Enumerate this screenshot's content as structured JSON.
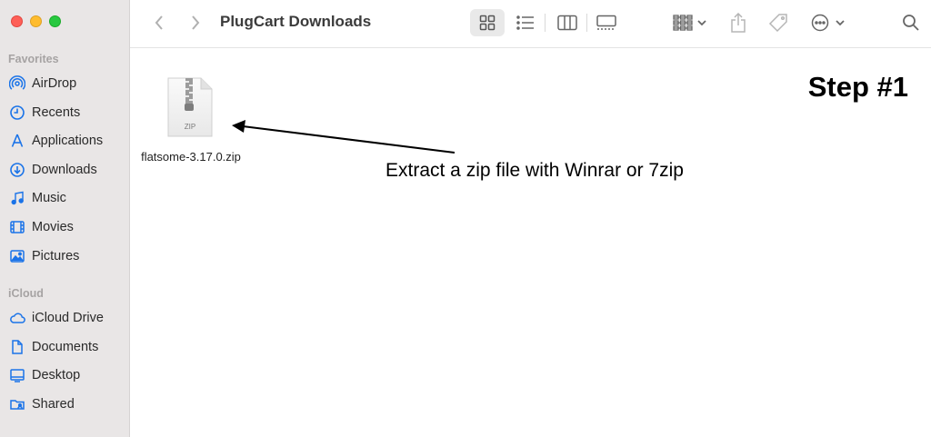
{
  "window": {
    "title": "PlugCart Downloads"
  },
  "sidebar": {
    "favorites_header": "Favorites",
    "favorites": [
      {
        "label": "AirDrop",
        "icon": "airdrop-icon"
      },
      {
        "label": "Recents",
        "icon": "clock-icon"
      },
      {
        "label": "Applications",
        "icon": "applications-icon"
      },
      {
        "label": "Downloads",
        "icon": "download-icon"
      },
      {
        "label": "Music",
        "icon": "music-note-icon"
      },
      {
        "label": "Movies",
        "icon": "film-icon"
      },
      {
        "label": "Pictures",
        "icon": "photo-icon"
      }
    ],
    "icloud_header": "iCloud",
    "icloud": [
      {
        "label": "iCloud Drive",
        "icon": "cloud-icon"
      },
      {
        "label": "Documents",
        "icon": "document-icon"
      },
      {
        "label": "Desktop",
        "icon": "desktop-icon"
      },
      {
        "label": "Shared",
        "icon": "shared-folder-icon"
      }
    ]
  },
  "toolbar": {
    "buttons": [
      "back-icon",
      "forward-icon",
      "grid-view-icon",
      "list-view-icon",
      "column-view-icon",
      "gallery-view-icon",
      "group-icon",
      "share-icon",
      "tag-icon",
      "more-icon",
      "search-icon"
    ],
    "selected_view": "grid-view-icon"
  },
  "files": [
    {
      "name": "flatsome-3.17.0.zip",
      "badge": "ZIP"
    }
  ],
  "annotations": {
    "step": "Step #1",
    "instruction": "Extract a zip file with Winrar or 7zip"
  },
  "colors": {
    "accent": "#1a73e8",
    "sidebar_bg": "#e9e6e6"
  }
}
